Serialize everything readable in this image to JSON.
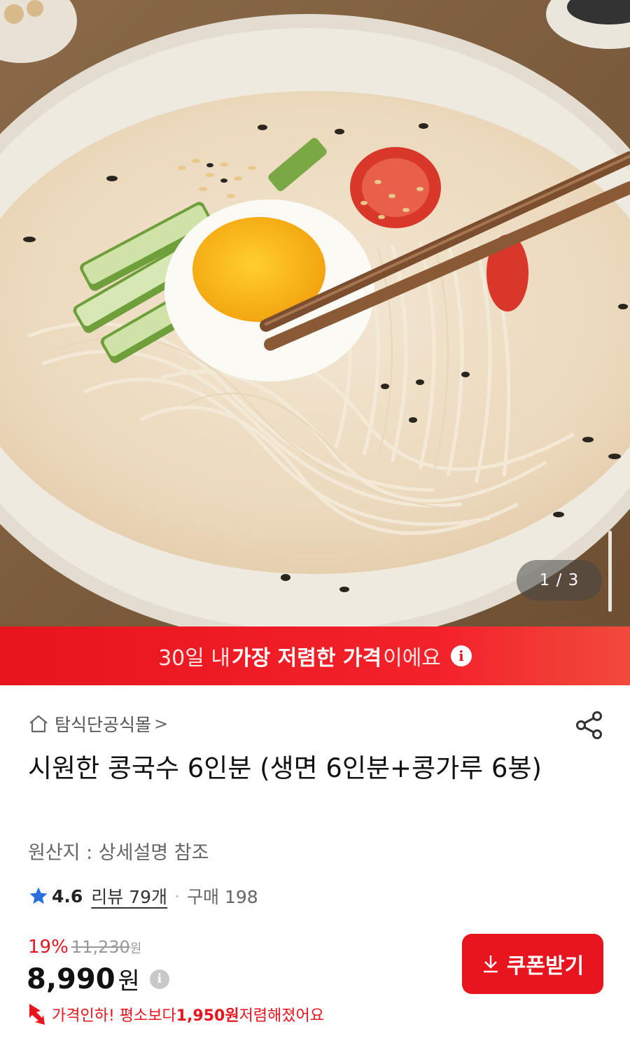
{
  "gallery": {
    "page_indicator": "1 / 3"
  },
  "promo_banner": {
    "prefix": "30일 내 ",
    "highlight": "가장 저렴한 가격",
    "suffix": "이에요",
    "info_glyph": "i"
  },
  "store": {
    "name": "탐식단공식몰",
    "chevron": ">",
    "icon": "home-icon"
  },
  "product": {
    "title": "시원한 콩국수 6인분 (생면 6인분+콩가루 6봉)",
    "origin": "원산지 : 상세설명 참조"
  },
  "rating": {
    "score": "4.6",
    "reviews": "리뷰 79개",
    "separator": "·",
    "purchases": "구매 198"
  },
  "pricing": {
    "discount_percent": "19%",
    "original_price": "11,230",
    "original_unit": "원",
    "price": "8,990",
    "price_unit": "원",
    "info_glyph": "i",
    "drop_prefix": "가격인하! 평소보다 ",
    "drop_amount": "1,950원",
    "drop_suffix": " 저렴해졌어요"
  },
  "coupon": {
    "label": "쿠폰받기"
  },
  "colors": {
    "accent": "#e8141e",
    "star": "#2a6fe0"
  }
}
